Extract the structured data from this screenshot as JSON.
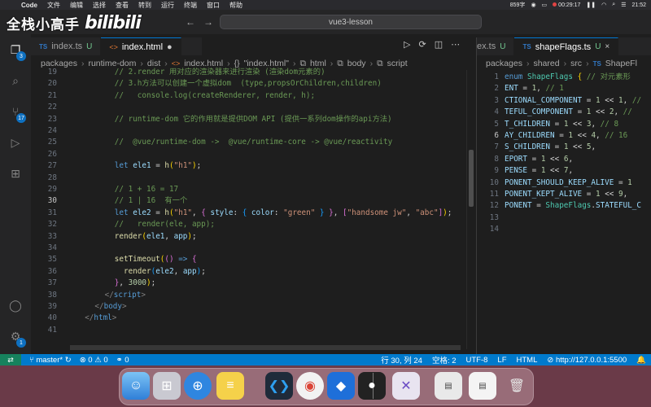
{
  "watermark": {
    "text": "全栈小高手",
    "logo": "bilibili"
  },
  "menubar": {
    "app": "Code",
    "items": [
      "文件",
      "编辑",
      "选择",
      "查看",
      "转到",
      "运行",
      "终端",
      "窗口",
      "帮助"
    ],
    "status": [
      "859字",
      "00:29:17"
    ],
    "time": "21:52"
  },
  "command_center": {
    "text": "vue3-lesson"
  },
  "tabs_left": [
    {
      "label": "index.ts",
      "type": "ts",
      "status": "U",
      "active": false
    },
    {
      "label": "index.html",
      "type": "html",
      "status": "●",
      "active": true
    }
  ],
  "tabs_right": [
    {
      "label": "ex.ts",
      "type": "ts",
      "status": "U",
      "active": false
    },
    {
      "label": "shapeFlags.ts",
      "type": "ts",
      "status": "U",
      "active": true
    }
  ],
  "breadcrumb_left": [
    "packages",
    "runtime-dom",
    "dist",
    "index.html",
    "\"index.html\"",
    "html",
    "body",
    "script"
  ],
  "breadcrumb_right": [
    "packages",
    "shared",
    "src",
    "ShapeFl"
  ],
  "editor_left": {
    "current_line": 30,
    "lines": [
      {
        "n": 19,
        "html": "<span class='c-com'>// 2.render 用对应的渲染器来进行渲染 (渲染dom元素的)</span>"
      },
      {
        "n": 20,
        "html": "<span class='c-com'>// 3.h方法可以创建一个虚拟dom  (type,propsOrChildren,children)</span>"
      },
      {
        "n": 21,
        "html": "<span class='c-com'>//   console.log(createRenderer, render, h);</span>"
      },
      {
        "n": 22,
        "html": ""
      },
      {
        "n": 23,
        "html": "<span class='c-com'>// runtime-dom 它的作用就是提供DOM API (提供一系列dom操作的api方法)</span>"
      },
      {
        "n": 24,
        "html": ""
      },
      {
        "n": 25,
        "html": "<span class='c-com'>//  @vue/runtime-dom ->  @vue/runtime-core -> @vue/reactivity</span>"
      },
      {
        "n": 26,
        "html": ""
      },
      {
        "n": 27,
        "html": "<span class='c-kw'>let</span> <span class='c-var'>ele1</span> <span class='c-pun'>=</span> <span class='c-fn'>h</span><span class='c-br2'>(</span><span class='c-str'>\"h1\"</span><span class='c-br2'>)</span><span class='c-pun'>;</span>"
      },
      {
        "n": 28,
        "html": ""
      },
      {
        "n": 29,
        "html": "<span class='c-com'>// 1 + 16 = 17</span>"
      },
      {
        "n": 30,
        "html": "<span class='c-com'>// 1 | 16  有一个</span>"
      },
      {
        "n": 31,
        "html": "<span class='c-kw'>let</span> <span class='c-var'>ele2</span> <span class='c-pun'>=</span> <span class='c-fn'>h</span><span class='c-br2'>(</span><span class='c-str'>\"h1\"</span><span class='c-pun'>,</span> <span class='c-br'>{</span> <span class='c-var'>style</span><span class='c-pun'>:</span> <span class='c-br3'>{</span> <span class='c-var'>color</span><span class='c-pun'>:</span> <span class='c-str'>\"green\"</span> <span class='c-br3'>}</span> <span class='c-br'>}</span><span class='c-pun'>,</span> <span class='c-br'>[</span><span class='c-str'>\"handsome jw\"</span><span class='c-pun'>,</span> <span class='c-str'>\"abc\"</span><span class='c-br'>]</span><span class='c-br2'>)</span><span class='c-pun'>;</span>"
      },
      {
        "n": 32,
        "html": "<span class='c-com'>//   render(ele, app);</span>"
      },
      {
        "n": 33,
        "html": "<span class='c-fn'>render</span><span class='c-br2'>(</span><span class='c-var'>ele1</span><span class='c-pun'>,</span> <span class='c-var'>app</span><span class='c-br2'>)</span><span class='c-pun'>;</span>"
      },
      {
        "n": 34,
        "html": ""
      },
      {
        "n": 35,
        "html": "<span class='c-fn'>setTimeout</span><span class='c-br2'>(</span><span class='c-br'>()</span> <span class='c-kw'>=&gt;</span> <span class='c-br'>{</span>"
      },
      {
        "n": 36,
        "html": "  <span class='c-fn'>render</span><span class='c-br3'>(</span><span class='c-var'>ele2</span><span class='c-pun'>,</span> <span class='c-var'>app</span><span class='c-br3'>)</span><span class='c-pun'>;</span>"
      },
      {
        "n": 37,
        "html": "<span class='c-br'>}</span><span class='c-pun'>,</span> <span class='c-num'>3000</span><span class='c-br2'>)</span><span class='c-pun'>;</span>"
      },
      {
        "n": 38,
        "html": "<span class='c-tag'>&lt;/</span><span class='c-tagn'>script</span><span class='c-tag'>&gt;</span>"
      },
      {
        "n": 39,
        "html": "<span class='c-tag'>&lt;/</span><span class='c-tagn'>body</span><span class='c-tag'>&gt;</span>"
      },
      {
        "n": 40,
        "html": "<span class='c-tag'>&lt;/</span><span class='c-tagn'>html</span><span class='c-tag'>&gt;</span>"
      },
      {
        "n": 41,
        "html": ""
      }
    ],
    "indents": [
      4,
      4,
      4,
      0,
      4,
      0,
      4,
      0,
      4,
      0,
      4,
      4,
      4,
      4,
      4,
      0,
      4,
      4,
      4,
      3,
      2,
      1,
      0
    ]
  },
  "editor_right": {
    "current_line": 6,
    "lines": [
      {
        "n": 1,
        "html": "<span class='c-kw'>enum</span> <span class='c-cls'>ShapeFlags</span> <span class='c-br2'>{</span> <span class='c-com'>// 对元素形</span>"
      },
      {
        "n": 2,
        "html": "<span class='c-var'>ENT</span> <span class='c-pun'>=</span> <span class='c-num'>1</span><span class='c-pun'>,</span> <span class='c-com'>// 1</span>"
      },
      {
        "n": 3,
        "html": "<span class='c-var'>CTIONAL_COMPONENT</span> <span class='c-pun'>=</span> <span class='c-num'>1</span> <span class='c-pun'>&lt;&lt;</span> <span class='c-num'>1</span><span class='c-pun'>,</span> <span class='c-com'>//</span>"
      },
      {
        "n": 4,
        "html": "<span class='c-var'>TEFUL_COMPONENT</span> <span class='c-pun'>=</span> <span class='c-num'>1</span> <span class='c-pun'>&lt;&lt;</span> <span class='c-num'>2</span><span class='c-pun'>,</span> <span class='c-com'>//</span>"
      },
      {
        "n": 5,
        "html": "<span class='c-var'>T_CHILDREN</span> <span class='c-pun'>=</span> <span class='c-num'>1</span> <span class='c-pun'>&lt;&lt;</span> <span class='c-num'>3</span><span class='c-pun'>,</span> <span class='c-com'>// 8</span>"
      },
      {
        "n": 6,
        "html": "<span class='c-var'>AY_CHILDREN</span> <span class='c-pun'>=</span> <span class='c-num'>1</span> <span class='c-pun'>&lt;&lt;</span> <span class='c-num'>4</span><span class='c-pun'>,</span> <span class='c-com'>// 16</span>"
      },
      {
        "n": 7,
        "html": "<span class='c-var'>S_CHILDREN</span> <span class='c-pun'>=</span> <span class='c-num'>1</span> <span class='c-pun'>&lt;&lt;</span> <span class='c-num'>5</span><span class='c-pun'>,</span>"
      },
      {
        "n": 8,
        "html": "<span class='c-var'>EPORT</span> <span class='c-pun'>=</span> <span class='c-num'>1</span> <span class='c-pun'>&lt;&lt;</span> <span class='c-num'>6</span><span class='c-pun'>,</span>"
      },
      {
        "n": 9,
        "html": "<span class='c-var'>PENSE</span> <span class='c-pun'>=</span> <span class='c-num'>1</span> <span class='c-pun'>&lt;&lt;</span> <span class='c-num'>7</span><span class='c-pun'>,</span>"
      },
      {
        "n": 10,
        "html": "<span class='c-var'>PONENT_SHOULD_KEEP_ALIVE</span> <span class='c-pun'>=</span> <span class='c-num'>1</span>"
      },
      {
        "n": 11,
        "html": "<span class='c-var'>PONENT_KEPT_ALIVE</span> <span class='c-pun'>=</span> <span class='c-num'>1</span> <span class='c-pun'>&lt;&lt;</span> <span class='c-num'>9</span><span class='c-pun'>,</span>"
      },
      {
        "n": 12,
        "html": "<span class='c-var'>PONENT</span> <span class='c-pun'>=</span> <span class='c-cls'>ShapeFlags</span><span class='c-pun'>.</span><span class='c-var'>STATEFUL_C</span>"
      },
      {
        "n": 13,
        "html": ""
      },
      {
        "n": 14,
        "html": ""
      }
    ]
  },
  "statusbar": {
    "remote": "⇄",
    "branch": "master*",
    "sync": "↻",
    "problems": "⊗ 0 ⚠ 0",
    "ports": "⚭ 0",
    "position": "行 30, 列 24",
    "spaces": "空格: 2",
    "encoding": "UTF-8",
    "eol": "LF",
    "language": "HTML",
    "live_server": "⊘ http://127.0.0.1:5500",
    "bell": "🔔"
  },
  "activity_badges": {
    "explorer": "3",
    "scm": "17",
    "settings": "1"
  },
  "dock_apps": [
    "finder",
    "launchpad",
    "safari",
    "notes",
    "vscode",
    "chrome",
    "qq-browser",
    "obs",
    "vscode-insiders",
    "window-preview-1",
    "window-preview-2",
    "trash"
  ],
  "colors": {
    "accent": "#007acc",
    "tab_border": "#0078d4",
    "untracked": "#73c991",
    "remote": "#16825d"
  }
}
